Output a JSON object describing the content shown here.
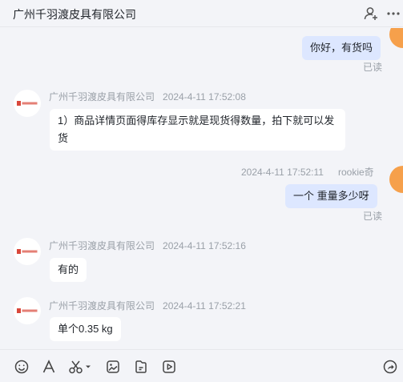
{
  "header": {
    "title": "广州千羽渡皮具有限公司",
    "icons": [
      "add-contact-icon",
      "more-icon"
    ]
  },
  "messages": [
    {
      "side": "right",
      "text": "你好，有货吗",
      "status": "已读"
    },
    {
      "side": "left",
      "sender": "广州千羽渡皮具有限公司",
      "time": "2024-4-11 17:52:08",
      "text": "1）商品详情页面得库存显示就是现货得数量，拍下就可以发货"
    },
    {
      "side": "right",
      "sender": "rookie奇",
      "time": "2024-4-11 17:52:11",
      "text": "一个  重量多少呀",
      "status": "已读"
    },
    {
      "side": "left",
      "sender": "广州千羽渡皮具有限公司",
      "time": "2024-4-11 17:52:16",
      "text": "有的"
    },
    {
      "side": "left",
      "sender": "广州千羽渡皮具有限公司",
      "time": "2024-4-11 17:52:21",
      "text": "单个0.35 kg"
    }
  ],
  "toolbar": {
    "icons": [
      "emoji-icon",
      "font-icon",
      "screenshot-icon",
      "image-icon",
      "file-icon",
      "video-icon",
      "share-icon"
    ]
  },
  "colors": {
    "background": "#f3f4f8",
    "my_bubble": "#dde7ff",
    "other_bubble": "#ffffff",
    "meta_text": "#9aa0a8",
    "logo_red": "#d9483b"
  }
}
